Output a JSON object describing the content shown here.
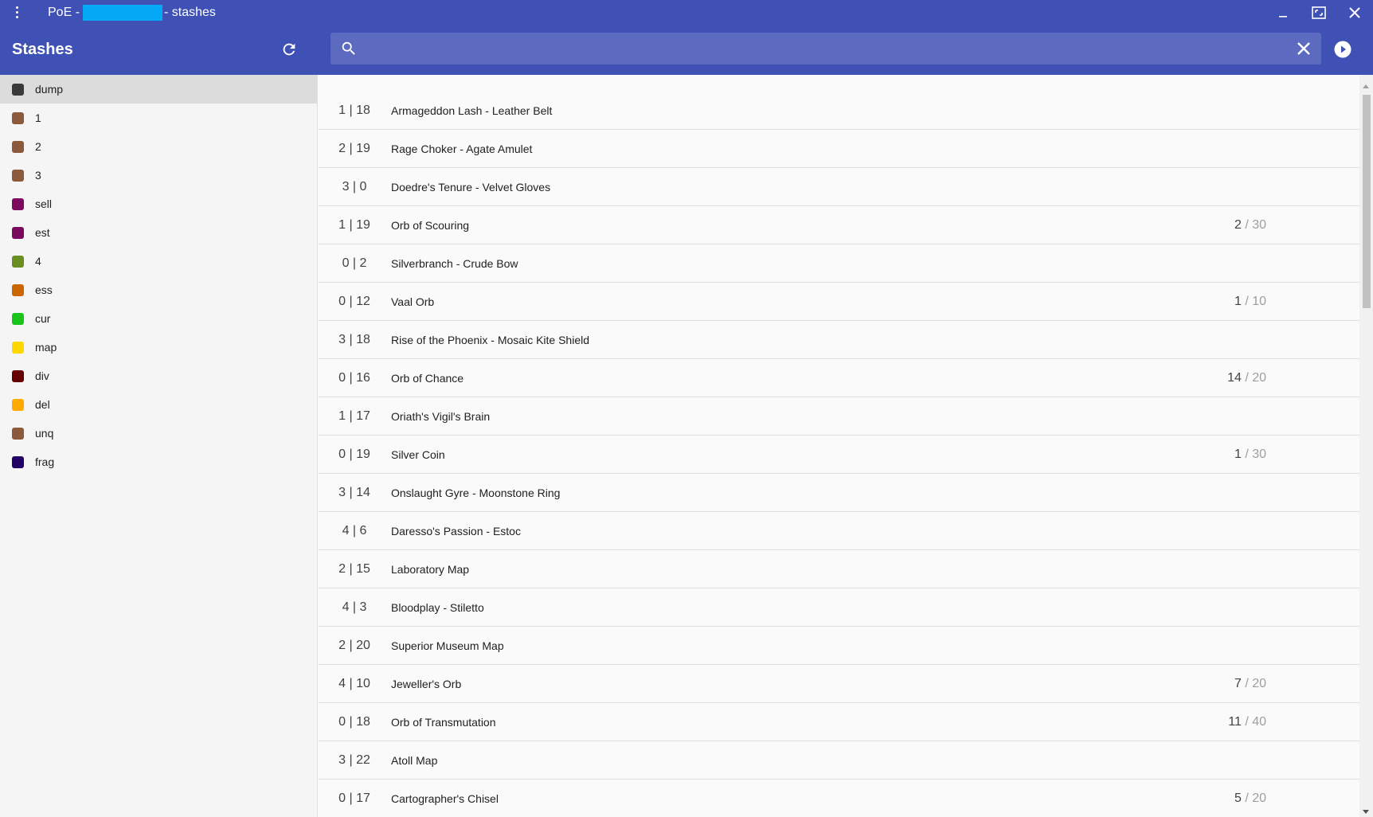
{
  "window": {
    "title_prefix": "PoE -",
    "title_suffix": "- stashes"
  },
  "header": {
    "title": "Stashes",
    "search_value": ""
  },
  "stashes": [
    {
      "label": "dump",
      "color": "#3a3a3a",
      "selected": true
    },
    {
      "label": "1",
      "color": "#8b5a3c"
    },
    {
      "label": "2",
      "color": "#8b5a3c"
    },
    {
      "label": "3",
      "color": "#8b5a3c"
    },
    {
      "label": "sell",
      "color": "#7b0a5e"
    },
    {
      "label": "est",
      "color": "#7b0a5e"
    },
    {
      "label": "4",
      "color": "#6b8e23"
    },
    {
      "label": "ess",
      "color": "#cc6600"
    },
    {
      "label": "cur",
      "color": "#1bc41b"
    },
    {
      "label": "map",
      "color": "#ffd700"
    },
    {
      "label": "div",
      "color": "#660000"
    },
    {
      "label": "del",
      "color": "#ffaa00"
    },
    {
      "label": "unq",
      "color": "#8b5a3c"
    },
    {
      "label": "frag",
      "color": "#220066"
    }
  ],
  "items": [
    {
      "pos": "1 | 18",
      "name": "Armageddon Lash - Leather Belt"
    },
    {
      "pos": "2 | 19",
      "name": "Rage Choker - Agate Amulet"
    },
    {
      "pos": "3 | 0",
      "name": "Doedre's Tenure - Velvet Gloves"
    },
    {
      "pos": "1 | 19",
      "name": "Orb of Scouring",
      "count": "2",
      "max": "/ 30"
    },
    {
      "pos": "0 | 2",
      "name": "Silverbranch - Crude Bow"
    },
    {
      "pos": "0 | 12",
      "name": "Vaal Orb",
      "count": "1",
      "max": "/ 10"
    },
    {
      "pos": "3 | 18",
      "name": "Rise of the Phoenix - Mosaic Kite Shield"
    },
    {
      "pos": "0 | 16",
      "name": "Orb of Chance",
      "count": "14",
      "max": "/ 20"
    },
    {
      "pos": "1 | 17",
      "name": "Oriath's Vigil's Brain"
    },
    {
      "pos": "0 | 19",
      "name": "Silver Coin",
      "count": "1",
      "max": "/ 30"
    },
    {
      "pos": "3 | 14",
      "name": "Onslaught Gyre - Moonstone Ring"
    },
    {
      "pos": "4 | 6",
      "name": "Daresso's Passion - Estoc"
    },
    {
      "pos": "2 | 15",
      "name": "Laboratory Map"
    },
    {
      "pos": "4 | 3",
      "name": "Bloodplay - Stiletto"
    },
    {
      "pos": "2 | 20",
      "name": "Superior Museum Map"
    },
    {
      "pos": "4 | 10",
      "name": "Jeweller's Orb",
      "count": "7",
      "max": "/ 20"
    },
    {
      "pos": "0 | 18",
      "name": "Orb of Transmutation",
      "count": "11",
      "max": "/ 40"
    },
    {
      "pos": "3 | 22",
      "name": "Atoll Map"
    },
    {
      "pos": "0 | 17",
      "name": "Cartographer's Chisel",
      "count": "5",
      "max": "/ 20"
    }
  ],
  "icons": {
    "menu": "more-vert-icon",
    "minimize": "minimize-icon",
    "maximize": "maximize-icon",
    "close": "close-icon",
    "refresh": "refresh-icon",
    "search": "search-icon",
    "clear": "clear-icon",
    "play": "play-circle-icon"
  },
  "colors": {
    "primary": "#3f51b5",
    "search_bg": "#5c6bc0",
    "redaction": "#03a9f4"
  }
}
